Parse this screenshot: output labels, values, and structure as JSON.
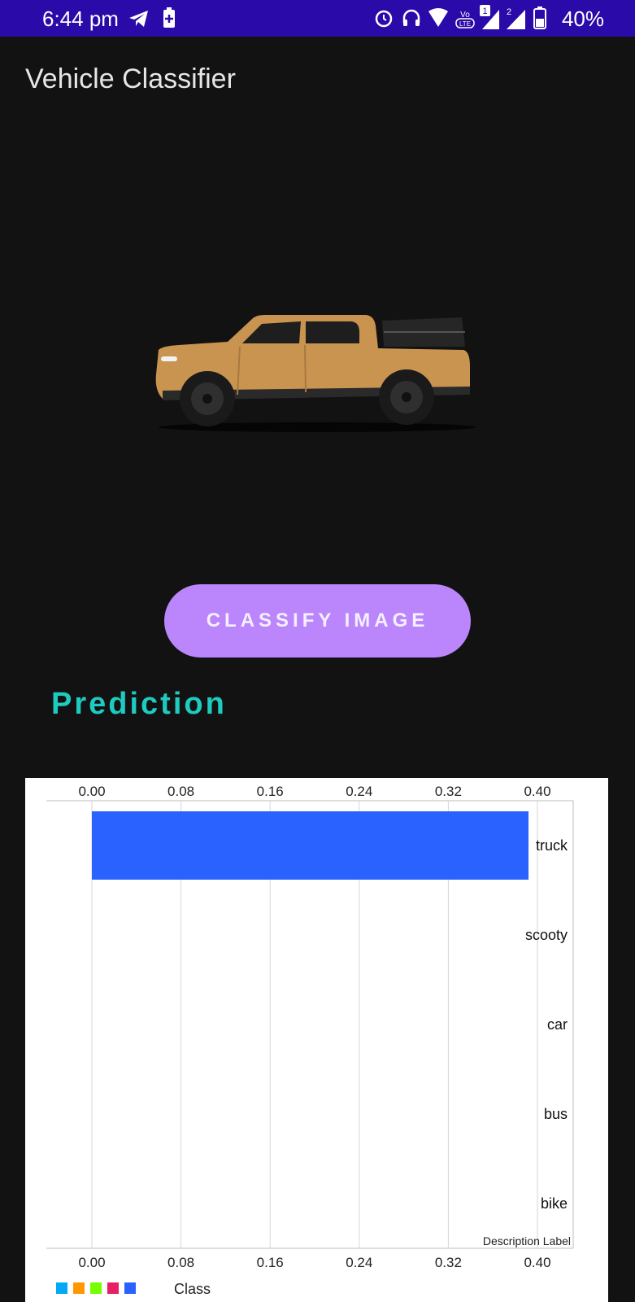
{
  "status_bar": {
    "time": "6:44 pm",
    "battery": "40%",
    "icons": [
      "telegram-icon",
      "battery-saver-icon",
      "alarm-icon",
      "headset-icon",
      "wifi-icon",
      "volte-icon",
      "signal-icon",
      "battery-icon"
    ],
    "volte_label": "Vo LTE",
    "sim1": "1",
    "sim2": "2"
  },
  "app": {
    "title": "Vehicle Classifier",
    "classify_button_label": "CLASSIFY IMAGE",
    "prediction_heading": "Prediction"
  },
  "colors": {
    "accent_button": "#bb86fc",
    "prediction_text": "#1ecbc0",
    "bar": "#2962ff",
    "status_bar": "#2a0aa8"
  },
  "chart_data": {
    "type": "bar",
    "orientation": "horizontal",
    "categories": [
      "truck",
      "scooty",
      "car",
      "bus",
      "bike"
    ],
    "series": [
      {
        "name": "Class",
        "values": [
          0.392,
          0,
          0,
          0,
          0
        ]
      }
    ],
    "xlim": [
      0,
      0.4
    ],
    "ticks": [
      "0.00",
      "0.08",
      "0.16",
      "0.24",
      "0.32",
      "0.40"
    ],
    "description_label": "Description Label",
    "grid": true,
    "legend": {
      "position": "bottom-left",
      "swatch_colors": [
        "#03a9f4",
        "#ff9800",
        "#76ff03",
        "#e91e63",
        "#2962ff"
      ],
      "label": "Class"
    }
  }
}
